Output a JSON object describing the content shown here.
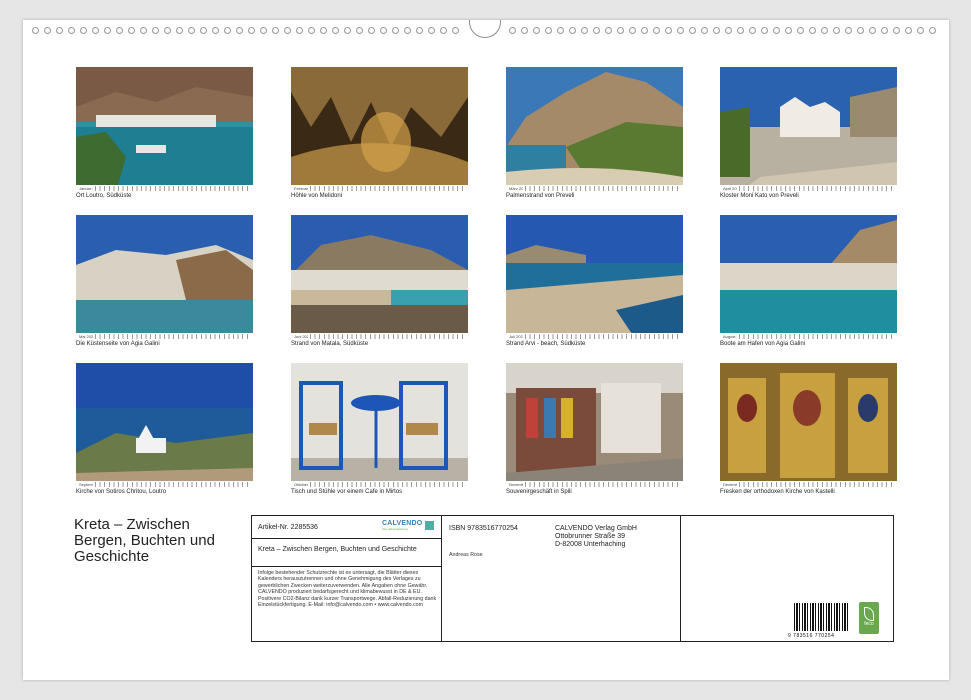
{
  "photos": [
    {
      "month": "Januar 2025",
      "caption": "Ort Loutro, Südküste"
    },
    {
      "month": "Februar 2025",
      "caption": "Höhle von Melidoni"
    },
    {
      "month": "März 2025",
      "caption": "Palmenstrand von Preveli"
    },
    {
      "month": "April 2025",
      "caption": "Kloster Moni Kato von Preveli"
    },
    {
      "month": "Mai 2025",
      "caption": "Die Küstenseite von Agia Galini"
    },
    {
      "month": "Juni 2025",
      "caption": "Strand von Matala, Südküste"
    },
    {
      "month": "Juli 2025",
      "caption": "Strand Arvi - beach, Südküste"
    },
    {
      "month": "August 2025",
      "caption": "Boote am Hafen von Agia Galini"
    },
    {
      "month": "September 2025",
      "caption": "Kirche von Sotiros Chritou, Loutro"
    },
    {
      "month": "Oktober 2025",
      "caption": "Tisch und Stühle vor einem Cafe in Mirtos"
    },
    {
      "month": "November 2025",
      "caption": "Souvenirgeschäft in Spili"
    },
    {
      "month": "Dezember 2025",
      "caption": "Fresken der orthodoxen Kirche von Kastelli"
    }
  ],
  "title": "Kreta – Zwischen Bergen, Buchten und Geschichte",
  "info": {
    "article": "Artikel-Nr. 2285536",
    "logo_name": "CALVENDO",
    "logo_sub": "Ihre Jahresplanung",
    "box_title": "Kreta – Zwischen Bergen, Buchten und Geschichte",
    "legal": "Infolge bestehender Schutzrechte ist es untersagt, die Blätter dieses Kalenders herauszutrennen und ohne Genehmigung des Verlages zu gewerblichen Zwecken weiterzuverwenden. Alle Angaben ohne Gewähr. CALVENDO produziert bedarfsgerecht und klimabewusst in DE & EU. Positivere CO2-Bilanz dank kurzer Transportwege. Abfall-Reduzierung dank Einzelstückfertigung. E-Mail: info@calvendo.com • www.calvendo.com",
    "isbn": "ISBN 9783516770254",
    "author": "Andreas Rose",
    "publisher_line1": "CALVENDO Verlag GmbH",
    "publisher_line2": "Ottobrunner Straße 39",
    "publisher_line3": "D-82008 Unterhaching",
    "barcode_number": "9 783516 770254",
    "feco_label": "feco"
  }
}
